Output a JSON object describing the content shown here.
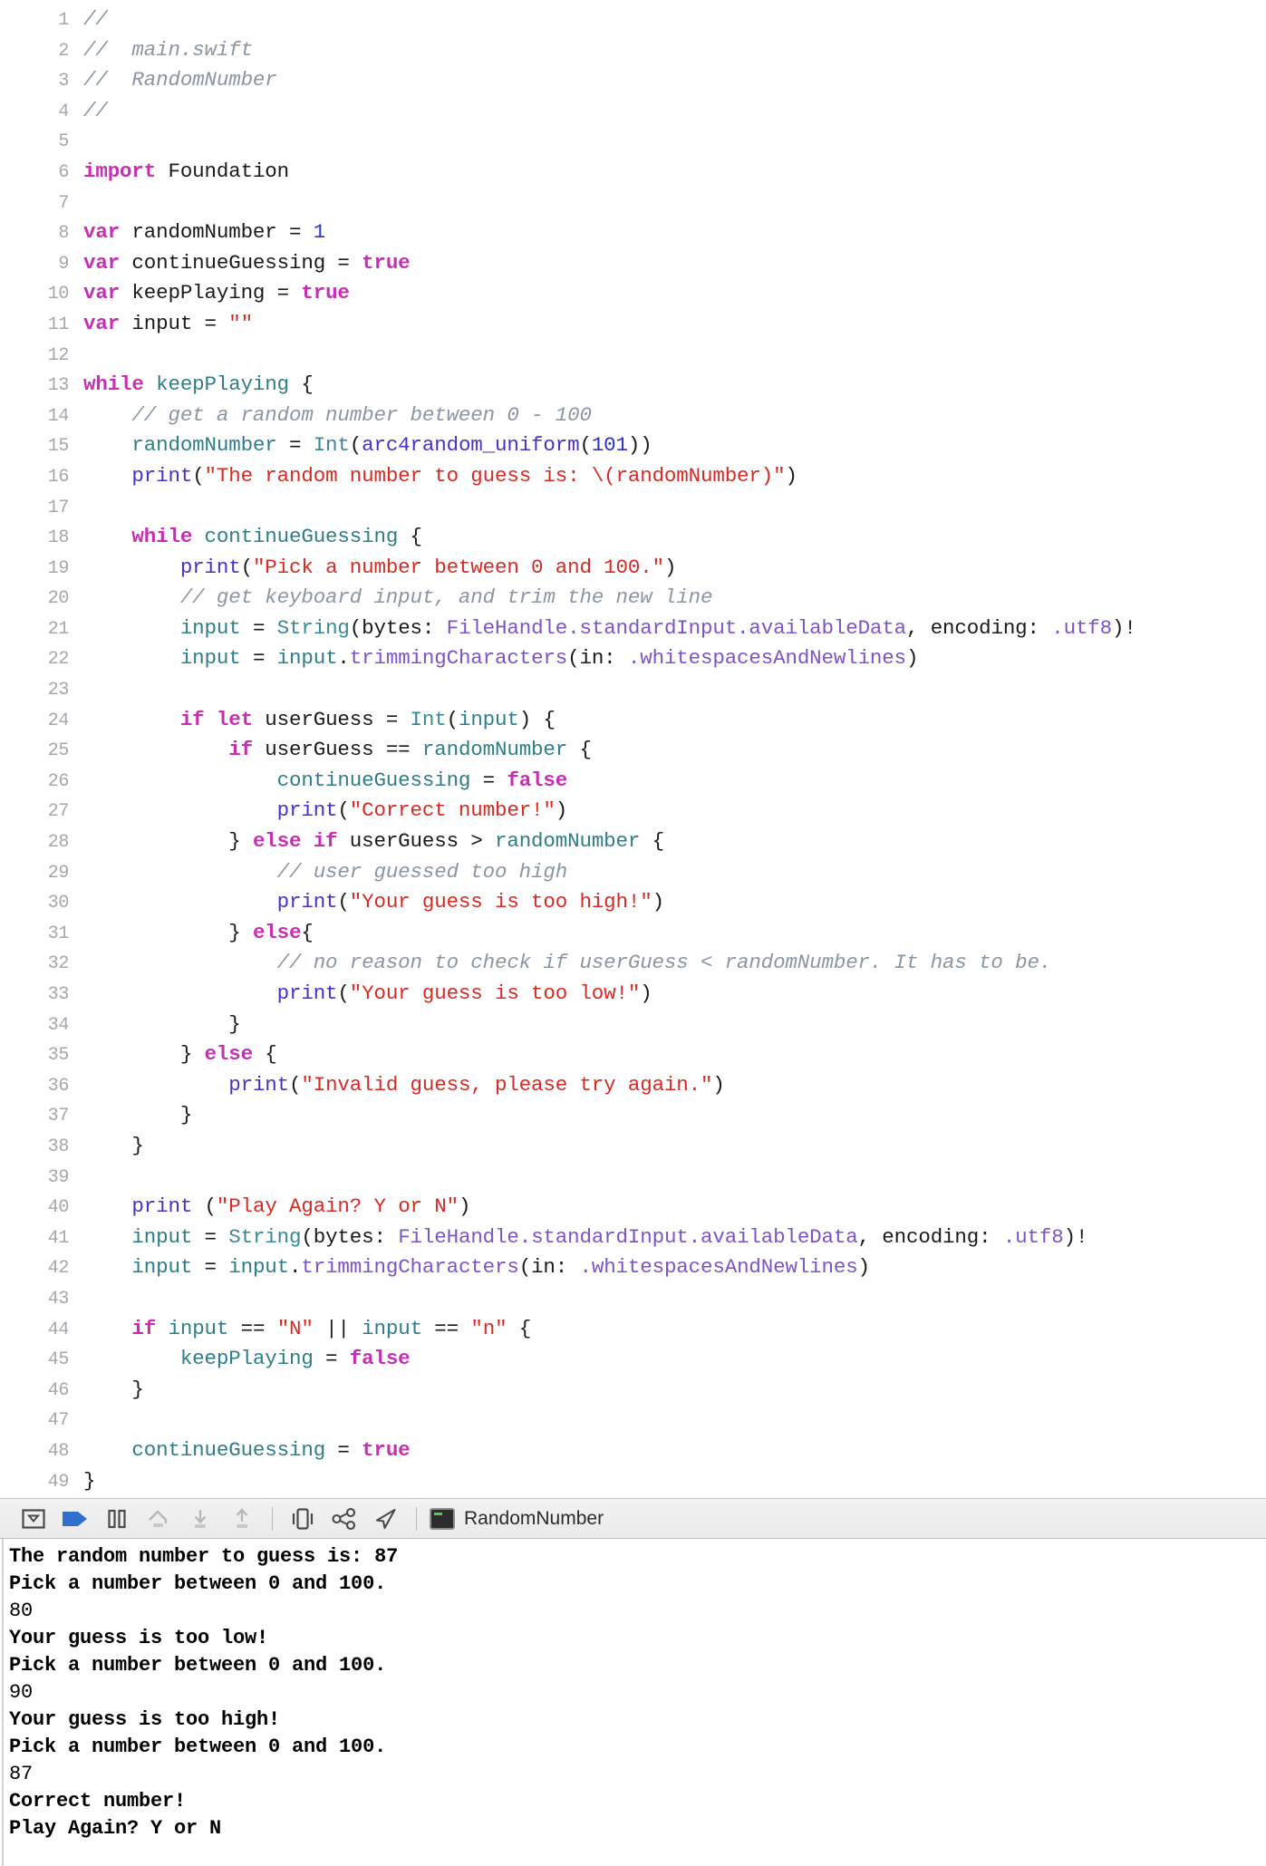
{
  "window": {
    "filename": "main.swift",
    "project": "RandomNumber"
  },
  "editor": {
    "language": "swift",
    "first_line_number": 1,
    "last_line_number": 49,
    "colors": {
      "comment": "#8a96a3",
      "keyword": "#c72fb2",
      "string": "#d62a23",
      "number": "#2b31c4",
      "function": "#4b2fc9",
      "type": "#3a8896",
      "property": "#7d53c8",
      "variable": "#2e7d88",
      "plain": "#1a1a1a",
      "gutter": "#a3a8ae",
      "background": "#ffffff"
    },
    "lines": [
      {
        "n": "1",
        "tokens": [
          {
            "c": "cmt",
            "t": "//"
          }
        ]
      },
      {
        "n": "2",
        "tokens": [
          {
            "c": "cmt",
            "t": "//  main.swift"
          }
        ]
      },
      {
        "n": "3",
        "tokens": [
          {
            "c": "cmt",
            "t": "//  RandomNumber"
          }
        ]
      },
      {
        "n": "4",
        "tokens": [
          {
            "c": "cmt",
            "t": "//"
          }
        ]
      },
      {
        "n": "5",
        "tokens": []
      },
      {
        "n": "6",
        "tokens": [
          {
            "c": "kw",
            "t": "import"
          },
          {
            "c": "plain",
            "t": " Foundation"
          }
        ]
      },
      {
        "n": "7",
        "tokens": []
      },
      {
        "n": "8",
        "tokens": [
          {
            "c": "kw",
            "t": "var"
          },
          {
            "c": "plain",
            "t": " randomNumber = "
          },
          {
            "c": "num",
            "t": "1"
          }
        ]
      },
      {
        "n": "9",
        "tokens": [
          {
            "c": "kw",
            "t": "var"
          },
          {
            "c": "plain",
            "t": " continueGuessing = "
          },
          {
            "c": "kw",
            "t": "true"
          }
        ]
      },
      {
        "n": "10",
        "tokens": [
          {
            "c": "kw",
            "t": "var"
          },
          {
            "c": "plain",
            "t": " keepPlaying = "
          },
          {
            "c": "kw",
            "t": "true"
          }
        ]
      },
      {
        "n": "11",
        "tokens": [
          {
            "c": "kw",
            "t": "var"
          },
          {
            "c": "plain",
            "t": " input = "
          },
          {
            "c": "str",
            "t": "\"\""
          }
        ]
      },
      {
        "n": "12",
        "tokens": []
      },
      {
        "n": "13",
        "tokens": [
          {
            "c": "kw",
            "t": "while"
          },
          {
            "c": "var",
            "t": " keepPlaying"
          },
          {
            "c": "plain",
            "t": " {"
          }
        ]
      },
      {
        "n": "14",
        "tokens": [
          {
            "c": "cmt",
            "t": "    // get a random number between 0 - 100"
          }
        ]
      },
      {
        "n": "15",
        "tokens": [
          {
            "c": "var",
            "t": "    randomNumber"
          },
          {
            "c": "plain",
            "t": " = "
          },
          {
            "c": "type",
            "t": "Int"
          },
          {
            "c": "plain",
            "t": "("
          },
          {
            "c": "fn",
            "t": "arc4random_uniform"
          },
          {
            "c": "plain",
            "t": "("
          },
          {
            "c": "num",
            "t": "101"
          },
          {
            "c": "plain",
            "t": "))"
          }
        ]
      },
      {
        "n": "16",
        "tokens": [
          {
            "c": "plain",
            "t": "    "
          },
          {
            "c": "fn",
            "t": "print"
          },
          {
            "c": "plain",
            "t": "("
          },
          {
            "c": "str",
            "t": "\"The random number to guess is: \\(randomNumber)\""
          },
          {
            "c": "plain",
            "t": ")"
          }
        ]
      },
      {
        "n": "17",
        "tokens": []
      },
      {
        "n": "18",
        "tokens": [
          {
            "c": "plain",
            "t": "    "
          },
          {
            "c": "kw",
            "t": "while"
          },
          {
            "c": "var",
            "t": " continueGuessing"
          },
          {
            "c": "plain",
            "t": " {"
          }
        ]
      },
      {
        "n": "19",
        "tokens": [
          {
            "c": "plain",
            "t": "        "
          },
          {
            "c": "fn",
            "t": "print"
          },
          {
            "c": "plain",
            "t": "("
          },
          {
            "c": "str",
            "t": "\"Pick a number between 0 and 100.\""
          },
          {
            "c": "plain",
            "t": ")"
          }
        ]
      },
      {
        "n": "20",
        "tokens": [
          {
            "c": "cmt",
            "t": "        // get keyboard input, and trim the new line"
          }
        ]
      },
      {
        "n": "21",
        "tokens": [
          {
            "c": "plain",
            "t": "        "
          },
          {
            "c": "var",
            "t": "input"
          },
          {
            "c": "plain",
            "t": " = "
          },
          {
            "c": "type",
            "t": "String"
          },
          {
            "c": "plain",
            "t": "(bytes: "
          },
          {
            "c": "prop",
            "t": "FileHandle.standardInput.availableData"
          },
          {
            "c": "plain",
            "t": ", encoding: "
          },
          {
            "c": "prop",
            "t": ".utf8"
          },
          {
            "c": "plain",
            "t": ")!"
          }
        ]
      },
      {
        "n": "22",
        "tokens": [
          {
            "c": "plain",
            "t": "        "
          },
          {
            "c": "var",
            "t": "input"
          },
          {
            "c": "plain",
            "t": " = "
          },
          {
            "c": "var",
            "t": "input"
          },
          {
            "c": "plain",
            "t": "."
          },
          {
            "c": "prop",
            "t": "trimmingCharacters"
          },
          {
            "c": "plain",
            "t": "(in: "
          },
          {
            "c": "prop",
            "t": ".whitespacesAndNewlines"
          },
          {
            "c": "plain",
            "t": ")"
          }
        ]
      },
      {
        "n": "23",
        "tokens": []
      },
      {
        "n": "24",
        "tokens": [
          {
            "c": "plain",
            "t": "        "
          },
          {
            "c": "kw",
            "t": "if let"
          },
          {
            "c": "plain",
            "t": " userGuess = "
          },
          {
            "c": "type",
            "t": "Int"
          },
          {
            "c": "plain",
            "t": "("
          },
          {
            "c": "var",
            "t": "input"
          },
          {
            "c": "plain",
            "t": ") {"
          }
        ]
      },
      {
        "n": "25",
        "tokens": [
          {
            "c": "plain",
            "t": "            "
          },
          {
            "c": "kw",
            "t": "if"
          },
          {
            "c": "plain",
            "t": " userGuess == "
          },
          {
            "c": "var",
            "t": "randomNumber"
          },
          {
            "c": "plain",
            "t": " {"
          }
        ]
      },
      {
        "n": "26",
        "tokens": [
          {
            "c": "var",
            "t": "                continueGuessing"
          },
          {
            "c": "plain",
            "t": " = "
          },
          {
            "c": "kw",
            "t": "false"
          }
        ]
      },
      {
        "n": "27",
        "tokens": [
          {
            "c": "plain",
            "t": "                "
          },
          {
            "c": "fn",
            "t": "print"
          },
          {
            "c": "plain",
            "t": "("
          },
          {
            "c": "str",
            "t": "\"Correct number!\""
          },
          {
            "c": "plain",
            "t": ")"
          }
        ]
      },
      {
        "n": "28",
        "tokens": [
          {
            "c": "plain",
            "t": "            } "
          },
          {
            "c": "kw",
            "t": "else if"
          },
          {
            "c": "plain",
            "t": " userGuess > "
          },
          {
            "c": "var",
            "t": "randomNumber"
          },
          {
            "c": "plain",
            "t": " {"
          }
        ]
      },
      {
        "n": "29",
        "tokens": [
          {
            "c": "cmt",
            "t": "                // user guessed too high"
          }
        ]
      },
      {
        "n": "30",
        "tokens": [
          {
            "c": "plain",
            "t": "                "
          },
          {
            "c": "fn",
            "t": "print"
          },
          {
            "c": "plain",
            "t": "("
          },
          {
            "c": "str",
            "t": "\"Your guess is too high!\""
          },
          {
            "c": "plain",
            "t": ")"
          }
        ]
      },
      {
        "n": "31",
        "tokens": [
          {
            "c": "plain",
            "t": "            } "
          },
          {
            "c": "kw",
            "t": "else"
          },
          {
            "c": "plain",
            "t": "{"
          }
        ]
      },
      {
        "n": "32",
        "tokens": [
          {
            "c": "cmt",
            "t": "                // no reason to check if userGuess < randomNumber. It has to be."
          }
        ]
      },
      {
        "n": "33",
        "tokens": [
          {
            "c": "plain",
            "t": "                "
          },
          {
            "c": "fn",
            "t": "print"
          },
          {
            "c": "plain",
            "t": "("
          },
          {
            "c": "str",
            "t": "\"Your guess is too low!\""
          },
          {
            "c": "plain",
            "t": ")"
          }
        ]
      },
      {
        "n": "34",
        "tokens": [
          {
            "c": "plain",
            "t": "            }"
          }
        ]
      },
      {
        "n": "35",
        "tokens": [
          {
            "c": "plain",
            "t": "        } "
          },
          {
            "c": "kw",
            "t": "else"
          },
          {
            "c": "plain",
            "t": " {"
          }
        ]
      },
      {
        "n": "36",
        "tokens": [
          {
            "c": "plain",
            "t": "            "
          },
          {
            "c": "fn",
            "t": "print"
          },
          {
            "c": "plain",
            "t": "("
          },
          {
            "c": "str",
            "t": "\"Invalid guess, please try again.\""
          },
          {
            "c": "plain",
            "t": ")"
          }
        ]
      },
      {
        "n": "37",
        "tokens": [
          {
            "c": "plain",
            "t": "        }"
          }
        ]
      },
      {
        "n": "38",
        "tokens": [
          {
            "c": "plain",
            "t": "    }"
          }
        ]
      },
      {
        "n": "39",
        "tokens": []
      },
      {
        "n": "40",
        "tokens": [
          {
            "c": "plain",
            "t": "    "
          },
          {
            "c": "fn",
            "t": "print"
          },
          {
            "c": "plain",
            "t": " ("
          },
          {
            "c": "str",
            "t": "\"Play Again? Y or N\""
          },
          {
            "c": "plain",
            "t": ")"
          }
        ]
      },
      {
        "n": "41",
        "tokens": [
          {
            "c": "plain",
            "t": "    "
          },
          {
            "c": "var",
            "t": "input"
          },
          {
            "c": "plain",
            "t": " = "
          },
          {
            "c": "type",
            "t": "String"
          },
          {
            "c": "plain",
            "t": "(bytes: "
          },
          {
            "c": "prop",
            "t": "FileHandle.standardInput.availableData"
          },
          {
            "c": "plain",
            "t": ", encoding: "
          },
          {
            "c": "prop",
            "t": ".utf8"
          },
          {
            "c": "plain",
            "t": ")!"
          }
        ]
      },
      {
        "n": "42",
        "tokens": [
          {
            "c": "plain",
            "t": "    "
          },
          {
            "c": "var",
            "t": "input"
          },
          {
            "c": "plain",
            "t": " = "
          },
          {
            "c": "var",
            "t": "input"
          },
          {
            "c": "plain",
            "t": "."
          },
          {
            "c": "prop",
            "t": "trimmingCharacters"
          },
          {
            "c": "plain",
            "t": "(in: "
          },
          {
            "c": "prop",
            "t": ".whitespacesAndNewlines"
          },
          {
            "c": "plain",
            "t": ")"
          }
        ]
      },
      {
        "n": "43",
        "tokens": []
      },
      {
        "n": "44",
        "tokens": [
          {
            "c": "plain",
            "t": "    "
          },
          {
            "c": "kw",
            "t": "if"
          },
          {
            "c": "var",
            "t": " input"
          },
          {
            "c": "plain",
            "t": " == "
          },
          {
            "c": "str",
            "t": "\"N\""
          },
          {
            "c": "plain",
            "t": " || "
          },
          {
            "c": "var",
            "t": "input"
          },
          {
            "c": "plain",
            "t": " == "
          },
          {
            "c": "str",
            "t": "\"n\""
          },
          {
            "c": "plain",
            "t": " {"
          }
        ]
      },
      {
        "n": "45",
        "tokens": [
          {
            "c": "var",
            "t": "        keepPlaying"
          },
          {
            "c": "plain",
            "t": " = "
          },
          {
            "c": "kw",
            "t": "false"
          }
        ]
      },
      {
        "n": "46",
        "tokens": [
          {
            "c": "plain",
            "t": "    }"
          }
        ]
      },
      {
        "n": "47",
        "tokens": []
      },
      {
        "n": "48",
        "tokens": [
          {
            "c": "var",
            "t": "    continueGuessing"
          },
          {
            "c": "plain",
            "t": " = "
          },
          {
            "c": "kw",
            "t": "true"
          }
        ]
      },
      {
        "n": "49",
        "tokens": [
          {
            "c": "plain",
            "t": "}"
          }
        ]
      }
    ]
  },
  "toolbar": {
    "buttons": [
      {
        "name": "hide-debug-area-button",
        "icon": "panel-collapse-icon",
        "tooltip": "Hide Debug Area"
      },
      {
        "name": "continue-button",
        "icon": "continue-arrow-icon",
        "tooltip": "Continue program execution",
        "active": true
      },
      {
        "name": "pause-button",
        "icon": "pause-icon",
        "tooltip": "Pause"
      },
      {
        "name": "step-over-button",
        "icon": "step-over-icon",
        "tooltip": "Step over",
        "dimmed": true
      },
      {
        "name": "step-into-button",
        "icon": "step-into-icon",
        "tooltip": "Step into",
        "dimmed": true
      },
      {
        "name": "step-out-button",
        "icon": "step-out-icon",
        "tooltip": "Step out",
        "dimmed": true
      },
      {
        "name": "separator-1",
        "icon": "separator",
        "tooltip": ""
      },
      {
        "name": "view-ui-hierarchy-button",
        "icon": "ui-hierarchy-icon",
        "tooltip": "Debug View Hierarchy"
      },
      {
        "name": "memory-graph-button",
        "icon": "memory-graph-icon",
        "tooltip": "Debug Memory Graph"
      },
      {
        "name": "simulate-location-button",
        "icon": "location-arrow-icon",
        "tooltip": "Simulate Location"
      },
      {
        "name": "separator-2",
        "icon": "separator",
        "tooltip": ""
      }
    ],
    "scheme_label": "RandomNumber",
    "scheme_icon": "terminal-app-icon",
    "accent_color": "#2f6fd0"
  },
  "console": {
    "lines": [
      {
        "text": "The random number to guess is: 87",
        "bold": true
      },
      {
        "text": "Pick a number between 0 and 100.",
        "bold": true
      },
      {
        "text": "80",
        "bold": false
      },
      {
        "text": "Your guess is too low!",
        "bold": true
      },
      {
        "text": "Pick a number between 0 and 100.",
        "bold": true
      },
      {
        "text": "90",
        "bold": false
      },
      {
        "text": "Your guess is too high!",
        "bold": true
      },
      {
        "text": "Pick a number between 0 and 100.",
        "bold": true
      },
      {
        "text": "87",
        "bold": false
      },
      {
        "text": "Correct number!",
        "bold": true
      },
      {
        "text": "Play Again? Y or N",
        "bold": true
      }
    ]
  }
}
